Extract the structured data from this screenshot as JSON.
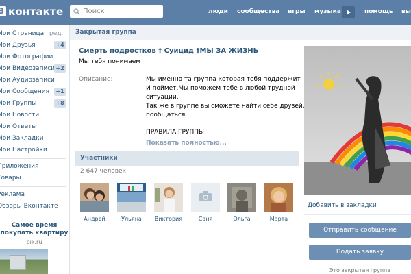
{
  "header": {
    "logo_mark": "В",
    "logo_text": "контакте",
    "search_placeholder": "Поиск",
    "nav": [
      "люди",
      "сообщества",
      "игры",
      "музыка",
      "помощь",
      "вы"
    ]
  },
  "sidebar": {
    "edit_label": "ред.",
    "items": [
      {
        "label": "Мои Страница"
      },
      {
        "label": "Мои Друзья",
        "badge": "+4"
      },
      {
        "label": "Мои Фотографии"
      },
      {
        "label": "Мои Видеозаписи",
        "badge": "+2"
      },
      {
        "label": "Мои Аудиозаписи"
      },
      {
        "label": "Мои Сообщения",
        "badge": "+1"
      },
      {
        "label": "Мои Группы",
        "badge": "+8"
      },
      {
        "label": "Мои Новости"
      },
      {
        "label": "Мои Ответы"
      },
      {
        "label": "Мои Закладки"
      },
      {
        "label": "Мои Настройки"
      }
    ],
    "items2": [
      "Приложения",
      "Товары"
    ],
    "items3": [
      "Реклама",
      "Обзоры Вконтакте"
    ],
    "ad": {
      "title_line1": "Самое время",
      "title_line2": "покупать квартиру",
      "source": "pik.ru"
    }
  },
  "breadcrumb": "Закрытая группа",
  "group": {
    "title": "Смерть подростков † Суицид †МЫ ЗА ЖИЗНЬ",
    "status": "Мы тебя понимаем",
    "description_label": "Описание:",
    "description_lines": [
      "Мы именно та группа которая тебя поддержит",
      "И поймет,Мы поможем тебе в любой трудной",
      "ситуации.",
      "Так же в группе вы сможете найти себе друзей,и",
      "пообщаться.",
      "",
      "ПРАВИЛА ГРУППЫ"
    ],
    "show_more": "Показать полностью..."
  },
  "members": {
    "title": "Участники",
    "count": "2 647 человек",
    "list": [
      {
        "name": "Андрей"
      },
      {
        "name": "Ульяна"
      },
      {
        "name": "Виктория"
      },
      {
        "name": "Саня"
      },
      {
        "name": "Ольга"
      },
      {
        "name": "Марта"
      }
    ]
  },
  "right": {
    "bookmark": "Добавить в закладки",
    "send_message": "Отправить сообщение",
    "submit_request": "Подать заявку",
    "closed_note": "Это закрытая группа"
  },
  "colors": {
    "header": "#5b7fa6",
    "link": "#2b587a",
    "button": "#6d8fb3"
  }
}
